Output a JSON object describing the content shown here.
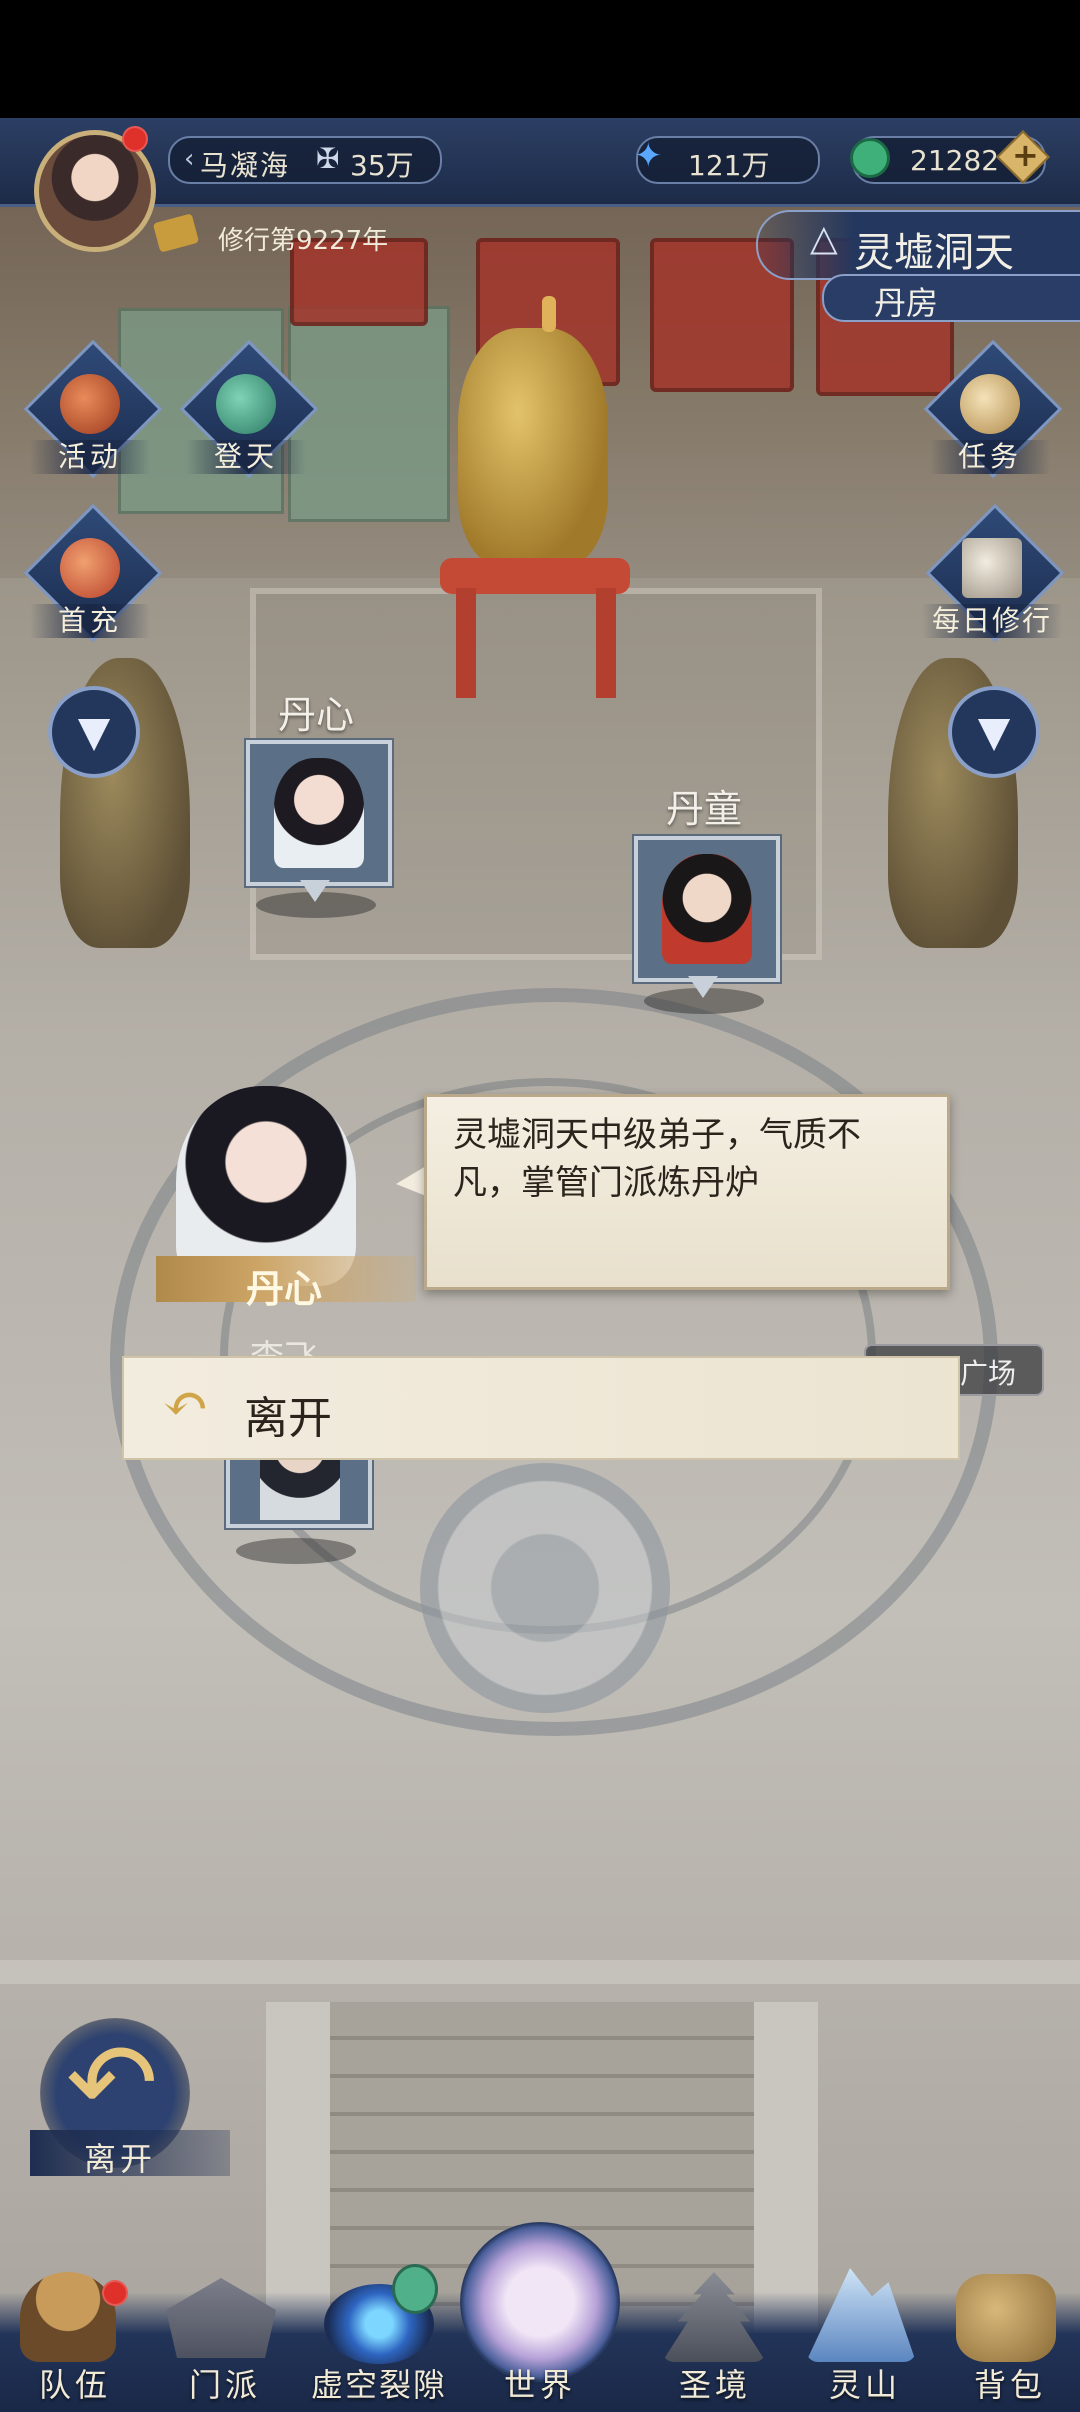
{
  "player": {
    "name": "马凝海",
    "power": "35万",
    "cultivation_year": "修行第9227年"
  },
  "currency": {
    "crystals": "121万",
    "jade": "21282"
  },
  "location": {
    "sect": "灵墟洞天",
    "room": "丹房"
  },
  "side_buttons": {
    "left": [
      {
        "label": "活动",
        "icon": "gift-bag-icon"
      },
      {
        "label": "登天",
        "icon": "jade-herb-icon"
      },
      {
        "label": "首充",
        "icon": "money-pouch-icon"
      }
    ],
    "right": [
      {
        "label": "任务",
        "icon": "scroll-bundle-icon"
      },
      {
        "label": "每日修行",
        "icon": "book-icon"
      }
    ]
  },
  "npcs": [
    {
      "name": "丹心"
    },
    {
      "name": "丹童"
    }
  ],
  "dialog": {
    "speaker": "丹心",
    "text": "灵墟洞天中级弟子，气质不凡，掌管门派炼丹炉",
    "options": [
      "离开"
    ]
  },
  "background_hints": {
    "npc_partial": "李飞",
    "area_partial": "广场"
  },
  "leave_button": {
    "label": "离开"
  },
  "bottom_nav": [
    {
      "label": "队伍",
      "icon": "hat-icon"
    },
    {
      "label": "门派",
      "icon": "temple-icon"
    },
    {
      "label": "虚空裂隙",
      "icon": "vortex-icon"
    },
    {
      "label": "世界",
      "icon": "world-orb-icon"
    },
    {
      "label": "圣境",
      "icon": "pagoda-icon"
    },
    {
      "label": "灵山",
      "icon": "mountain-icon"
    },
    {
      "label": "背包",
      "icon": "bag-icon"
    }
  ],
  "colors": {
    "top_bar": "#1d2b48",
    "dialog_bg": "#f4efe2",
    "name_gold": "#cda567",
    "red_dot": "#e0302a"
  }
}
